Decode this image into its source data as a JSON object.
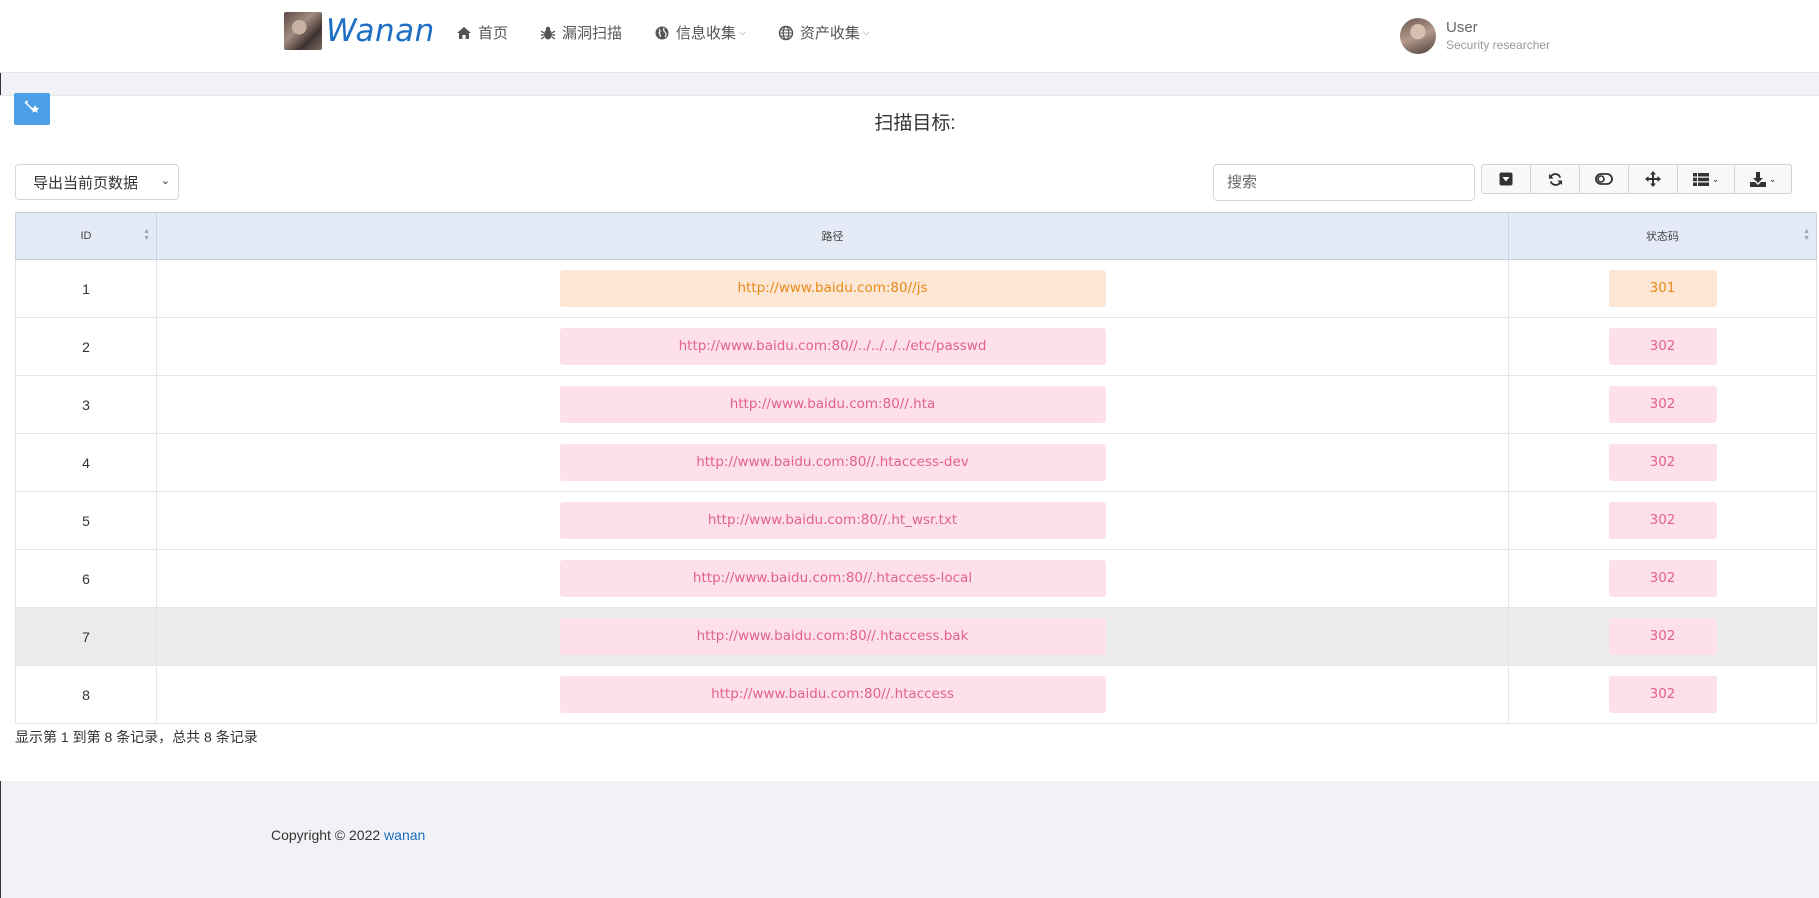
{
  "brand": {
    "name": "Wanan"
  },
  "nav": {
    "home": "首页",
    "vuln_scan": "漏洞扫描",
    "info_collect": "信息收集",
    "asset_collect": "资产收集"
  },
  "user": {
    "name": "User",
    "role": "Security researcher"
  },
  "page": {
    "title": "扫描目标:"
  },
  "export": {
    "label": "导出当前页数据"
  },
  "search": {
    "placeholder": "搜索"
  },
  "table": {
    "headers": {
      "id": "ID",
      "path": "路径",
      "status": "状态码"
    },
    "rows": [
      {
        "id": "1",
        "path": "http://www.baidu.com:80//js",
        "status": "301"
      },
      {
        "id": "2",
        "path": "http://www.baidu.com:80//../../../../etc/passwd",
        "status": "302"
      },
      {
        "id": "3",
        "path": "http://www.baidu.com:80//.hta",
        "status": "302"
      },
      {
        "id": "4",
        "path": "http://www.baidu.com:80//.htaccess-dev",
        "status": "302"
      },
      {
        "id": "5",
        "path": "http://www.baidu.com:80//.ht_wsr.txt",
        "status": "302"
      },
      {
        "id": "6",
        "path": "http://www.baidu.com:80//.htaccess-local",
        "status": "302"
      },
      {
        "id": "7",
        "path": "http://www.baidu.com:80//.htaccess.bak",
        "status": "302"
      },
      {
        "id": "8",
        "path": "http://www.baidu.com:80//.htaccess",
        "status": "302"
      }
    ]
  },
  "pagination": {
    "info": "显示第 1 到第 8 条记录，总共 8 条记录"
  },
  "footer": {
    "copyright": "Copyright © 2022 ",
    "link": "wanan"
  },
  "colors": {
    "brand": "#1d6fc4",
    "status_301_bg": "#fde6d4",
    "status_301_fg": "#e88a1a",
    "status_302_bg": "#fde0e8",
    "status_302_fg": "#e2628c",
    "header_bg": "#e4ebf6"
  }
}
